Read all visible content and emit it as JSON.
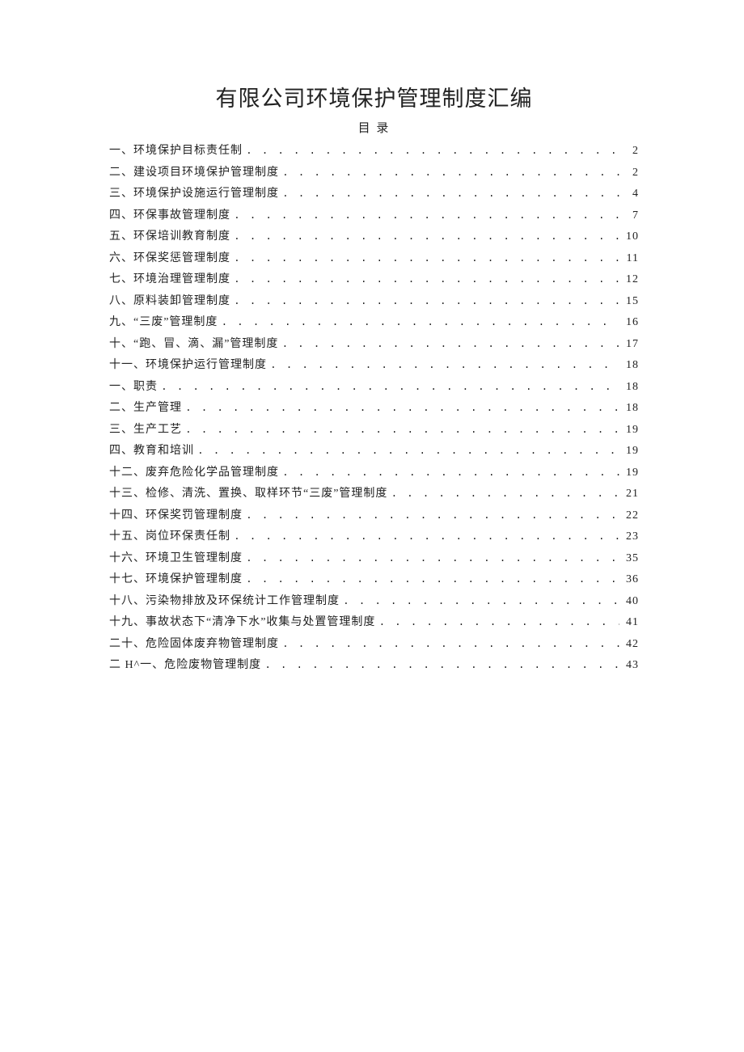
{
  "title": "有限公司环境保护管理制度汇编",
  "subtitle": "目 录",
  "toc": [
    {
      "label": "一、环境保护目标责任制",
      "page": "2"
    },
    {
      "label": "二、建设项目环境保护管理制度",
      "page": "2"
    },
    {
      "label": "三、环境保护设施运行管理制度",
      "page": "4"
    },
    {
      "label": "四、环保事故管理制度",
      "page": "7"
    },
    {
      "label": "五、环保培训教育制度",
      "page": "10"
    },
    {
      "label": "六、环保奖惩管理制度",
      "page": "11"
    },
    {
      "label": "七、环境治理管理制度",
      "page": "12"
    },
    {
      "label": "八、原料装卸管理制度",
      "page": "15"
    },
    {
      "label": "九、“三废”管理制度",
      "page": "16"
    },
    {
      "label": "十、“跑、冒、滴、漏”管理制度",
      "page": "17"
    },
    {
      "label": "十一、环境保护运行管理制度",
      "page": "18"
    },
    {
      "label": "一、职责",
      "page": "18"
    },
    {
      "label": "二、生产管理",
      "page": "18"
    },
    {
      "label": "三、生产工艺",
      "page": "19"
    },
    {
      "label": "四、教育和培训",
      "page": "19"
    },
    {
      "label": "十二、废弃危险化学品管理制度",
      "page": "19"
    },
    {
      "label": "十三、检修、清洗、置换、取样环节“三废”管理制度",
      "page": "21"
    },
    {
      "label": "十四、环保奖罚管理制度",
      "page": "22"
    },
    {
      "label": "十五、岗位环保责任制",
      "page": "23"
    },
    {
      "label": "十六、环境卫生管理制度",
      "page": "35"
    },
    {
      "label": "十七、环境保护管理制度",
      "page": "36"
    },
    {
      "label": "十八、污染物排放及环保统计工作管理制度",
      "page": "40"
    },
    {
      "label": "十九、事故状态下“清净下水”收集与处置管理制度",
      "page": "41"
    },
    {
      "label": "二十、危险固体废弃物管理制度",
      "page": "42"
    },
    {
      "label": "二 H^一、危险废物管理制度",
      "page": "43"
    }
  ]
}
